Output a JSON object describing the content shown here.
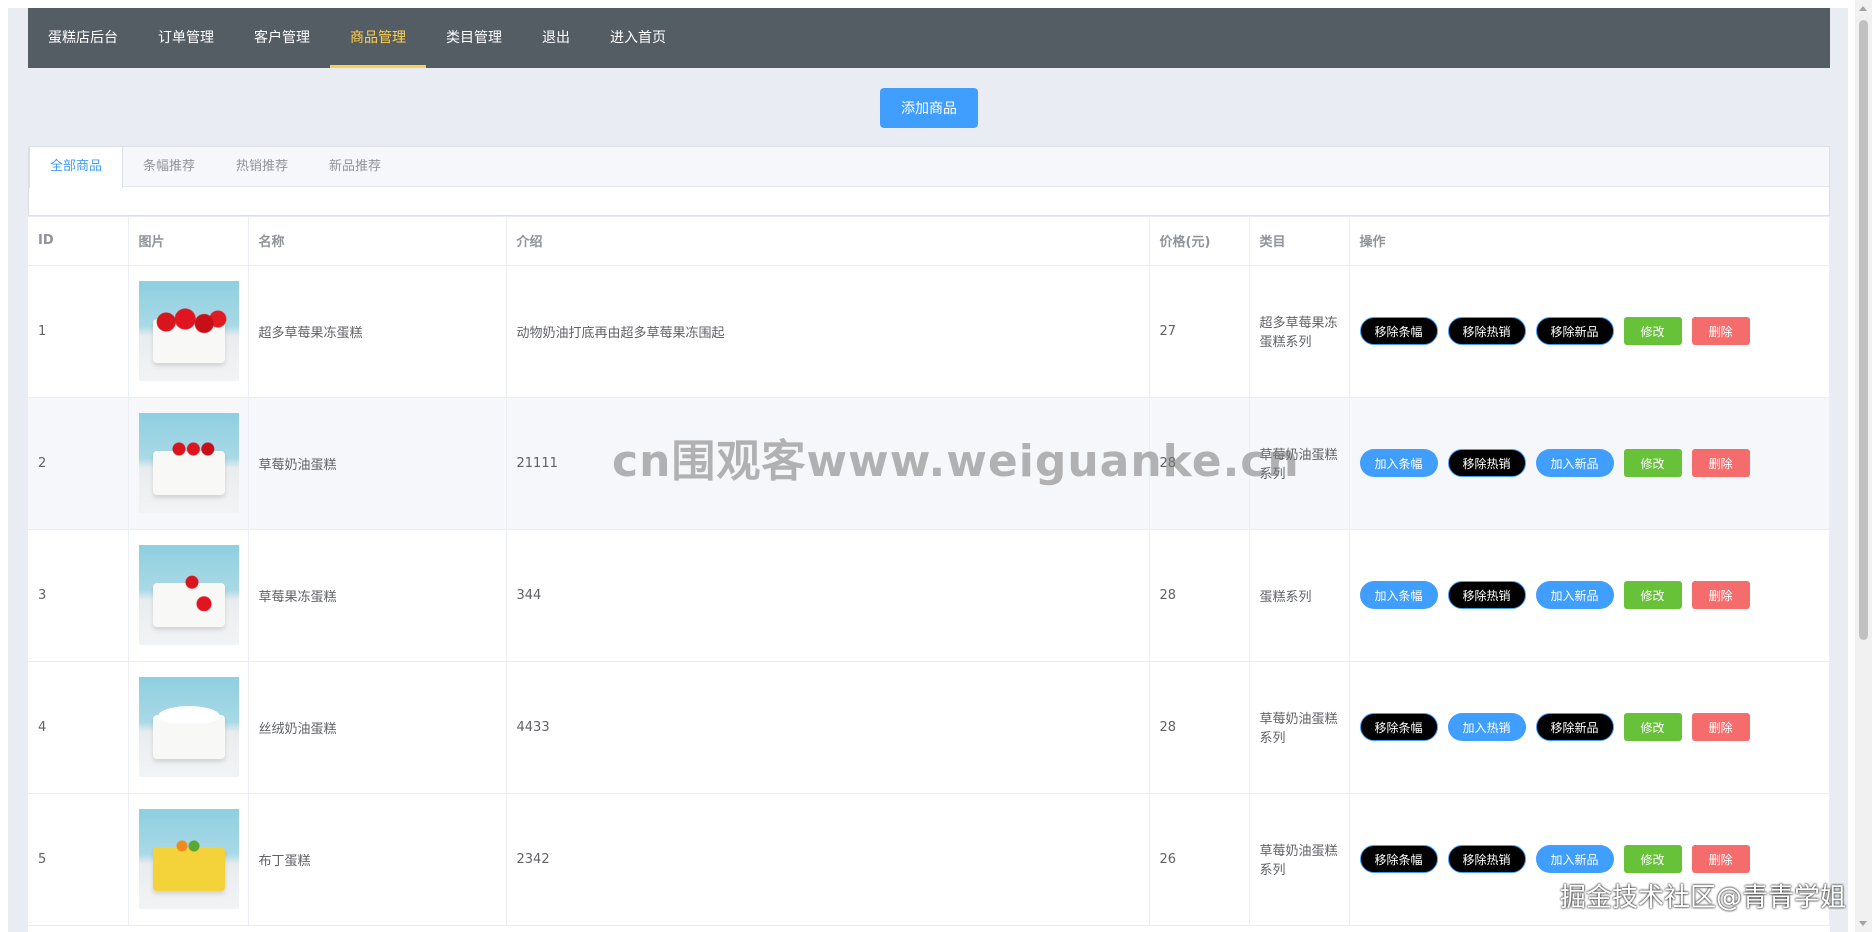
{
  "nav": {
    "items": [
      {
        "label": "蛋糕店后台",
        "active": false
      },
      {
        "label": "订单管理",
        "active": false
      },
      {
        "label": "客户管理",
        "active": false
      },
      {
        "label": "商品管理",
        "active": true
      },
      {
        "label": "类目管理",
        "active": false
      },
      {
        "label": "退出",
        "active": false
      },
      {
        "label": "进入首页",
        "active": false
      }
    ]
  },
  "toolbar": {
    "add_label": "添加商品"
  },
  "tabs": [
    "全部商品",
    "条幅推荐",
    "热销推荐",
    "新品推荐"
  ],
  "table": {
    "headers": [
      "ID",
      "图片",
      "名称",
      "介绍",
      "价格(元)",
      "类目",
      "操作"
    ],
    "rows": [
      {
        "id": "1",
        "name": "超多草莓果冻蛋糕",
        "intro": "动物奶油打底再由超多草莓果冻围起",
        "price": "27",
        "category": "超多草莓果冻蛋糕系列",
        "image": "cake-red",
        "ops": [
          {
            "label": "移除条幅",
            "style": "black"
          },
          {
            "label": "移除热销",
            "style": "black"
          },
          {
            "label": "移除新品",
            "style": "black"
          },
          {
            "label": "修改",
            "style": "edit"
          },
          {
            "label": "删除",
            "style": "del"
          }
        ]
      },
      {
        "id": "2",
        "name": "草莓奶油蛋糕",
        "intro": "21111",
        "price": "28",
        "category": "草莓奶油蛋糕系列",
        "image": "cake-berry",
        "ops": [
          {
            "label": "加入条幅",
            "style": "blue"
          },
          {
            "label": "移除热销",
            "style": "black"
          },
          {
            "label": "加入新品",
            "style": "blue"
          },
          {
            "label": "修改",
            "style": "edit"
          },
          {
            "label": "删除",
            "style": "del"
          }
        ]
      },
      {
        "id": "3",
        "name": "草莓果冻蛋糕",
        "intro": "344",
        "price": "28",
        "category": "蛋糕系列",
        "image": "cake-petal",
        "ops": [
          {
            "label": "加入条幅",
            "style": "blue"
          },
          {
            "label": "移除热销",
            "style": "black"
          },
          {
            "label": "加入新品",
            "style": "blue"
          },
          {
            "label": "修改",
            "style": "edit"
          },
          {
            "label": "删除",
            "style": "del"
          }
        ]
      },
      {
        "id": "4",
        "name": "丝绒奶油蛋糕",
        "intro": "4433",
        "price": "28",
        "category": "草莓奶油蛋糕系列",
        "image": "cake-cream",
        "ops": [
          {
            "label": "移除条幅",
            "style": "black"
          },
          {
            "label": "加入热销",
            "style": "blue"
          },
          {
            "label": "移除新品",
            "style": "black"
          },
          {
            "label": "修改",
            "style": "edit"
          },
          {
            "label": "删除",
            "style": "del"
          }
        ]
      },
      {
        "id": "5",
        "name": "布丁蛋糕",
        "intro": "2342",
        "price": "26",
        "category": "草莓奶油蛋糕系列",
        "image": "cake-pudding",
        "ops": [
          {
            "label": "移除条幅",
            "style": "black"
          },
          {
            "label": "移除热销",
            "style": "black"
          },
          {
            "label": "加入新品",
            "style": "blue"
          },
          {
            "label": "修改",
            "style": "edit"
          },
          {
            "label": "删除",
            "style": "del"
          }
        ]
      }
    ]
  },
  "watermark": "cn围观客www.weiguanke.cn",
  "corner_mark": "掘金技术社区@青青学姐",
  "colors": {
    "nav_bg": "#545c64",
    "nav_active": "#ffd04b",
    "primary": "#409eff",
    "success": "#67c23a",
    "danger": "#f56c6c"
  }
}
